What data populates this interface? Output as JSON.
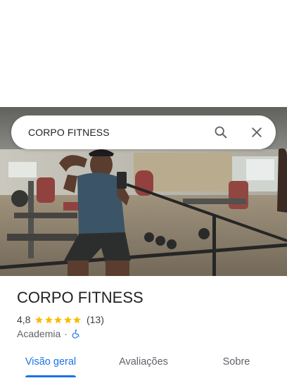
{
  "search": {
    "query": "CORPO FITNESS",
    "search_icon": "search-icon",
    "close_icon": "close-icon"
  },
  "place": {
    "name": "CORPO FITNESS",
    "rating": "4,8",
    "stars": 5,
    "review_count": "(13)",
    "category": "Academia",
    "separator": "·",
    "accessibility_icon": "wheelchair-icon"
  },
  "tabs": [
    {
      "label": "Visão geral",
      "active": true
    },
    {
      "label": "Avaliações",
      "active": false
    },
    {
      "label": "Sobre",
      "active": false
    }
  ],
  "colors": {
    "accent": "#1a73e8",
    "star": "#fbbc04",
    "text_primary": "#202124",
    "text_secondary": "#5f6368"
  }
}
